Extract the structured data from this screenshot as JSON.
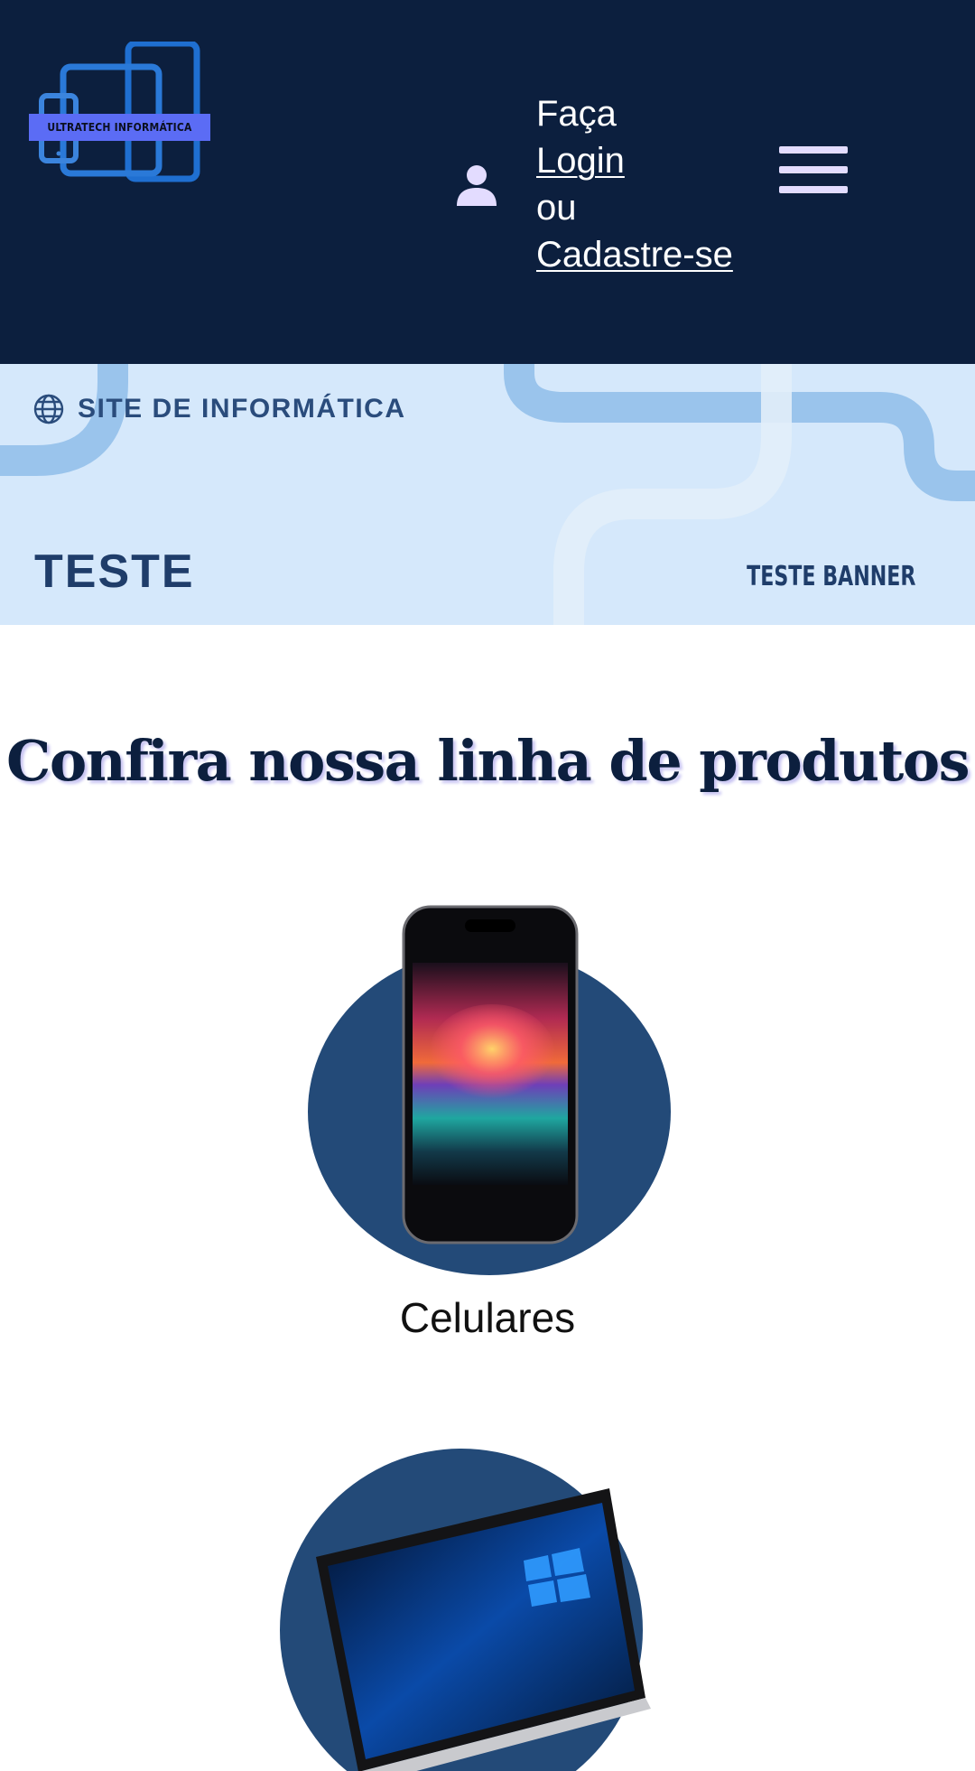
{
  "header": {
    "logo_text": "ULTRATECH INFORMÁTICA",
    "login": {
      "line1": "Faça",
      "login_link": "Login",
      "line3": "ou",
      "signup_link": "Cadastre-se"
    }
  },
  "banner": {
    "tag": "SITE DE INFORMÁTICA",
    "title": "TESTE",
    "subtitle": "TESTE BANNER"
  },
  "products_section": {
    "title": "Confira nossa linha de produtos",
    "items": [
      {
        "label": "Celulares",
        "image": "smartphone"
      },
      {
        "label": "",
        "image": "laptop"
      }
    ]
  },
  "colors": {
    "header_bg": "#0c1f3e",
    "banner_bg": "#d5e8fb",
    "circle_bg": "#234a78",
    "accent": "#5b6cf5"
  }
}
